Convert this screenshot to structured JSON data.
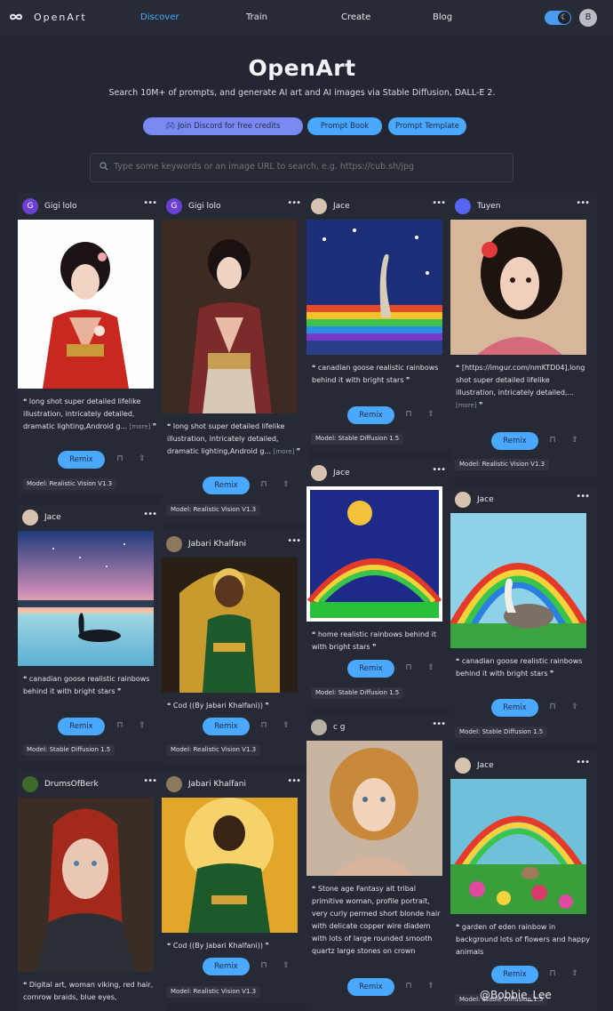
{
  "nav": {
    "brand": "OpenArt",
    "links": [
      "Discover",
      "Train",
      "Create",
      "Blog"
    ],
    "active": "Discover",
    "avatar_initial": "B"
  },
  "hero": {
    "title": "OpenArt",
    "subtitle": "Search 10M+ of prompts, and generate AI art and AI images via Stable Diffusion, DALL-E 2.",
    "buttons": {
      "discord": "Join Discord for free credits",
      "book": "Prompt Book",
      "template": "Prompt Template"
    }
  },
  "search": {
    "placeholder": "Type some keywords or an image URL to search, e.g. https://cub.sh/jpg"
  },
  "common": {
    "remix_label": "Remix",
    "more_label": "[more]"
  },
  "cards": [
    {
      "user": "Gigi lolo",
      "caption": "long shot super detailed lifelike illustration, intricately detailed, dramatic lighting,Android g...",
      "model": "Model: Realistic Vision V1.3"
    },
    {
      "user": "Jace",
      "caption": "canadian goose realistic rainbows behind it with bright stars",
      "model": "Model: Stable Diffusion 1.5"
    },
    {
      "user": "DrumsOfBerk",
      "caption": "Digital art, woman viking, red hair, cornrow braids, blue eyes,",
      "model": ""
    },
    {
      "user": "Gigi lolo",
      "caption": "long shot super detailed lifelike illustration, intricately detailed, dramatic lighting,Android g...",
      "model": "Model: Realistic Vision V1.3"
    },
    {
      "user": "Jabari Khalfani",
      "caption": "Cod ((By Jabari Khalfani))",
      "model": "Model: Realistic Vision V1.3"
    },
    {
      "user": "Jabari Khalfani",
      "caption": "Cod ((By Jabari Khalfani))",
      "model": "Model: Realistic Vision V1.3"
    },
    {
      "user": "Jace",
      "caption": "canadian goose realistic rainbows behind it with bright stars",
      "model": "Model: Stable Diffusion 1.5"
    },
    {
      "user": "Jace",
      "caption": "home realistic rainbows behind it with bright stars",
      "model": "Model: Stable Diffusion 1.5"
    },
    {
      "user": "c g",
      "caption": "Stone age Fantasy alt tribal primitive woman, profile portrait, very curly permed short blonde hair with delicate copper wire diadem with lots of large rounded smooth quartz large stones on crown",
      "model": ""
    },
    {
      "user": "Tuyen",
      "caption": "[https://imgur.com/nmKTD04],long shot super detailed lifelike illustration, intricately detailed,...",
      "model": "Model: Realistic Vision V1.3"
    },
    {
      "user": "Jace",
      "caption": "canadian goose realistic rainbows behind it with bright stars",
      "model": "Model: Stable Diffusion 1.5"
    },
    {
      "user": "Jace",
      "caption": "garden of eden rainbow in background lots of flowers and happy animals",
      "model": "Model: Stable Diffusion 1.5"
    }
  ],
  "watermark": "@Bobbie_Lee",
  "colors": {
    "bg": "#232733",
    "card": "#262a34",
    "accent": "#4aa8ff",
    "discord": "#7a88f2"
  }
}
